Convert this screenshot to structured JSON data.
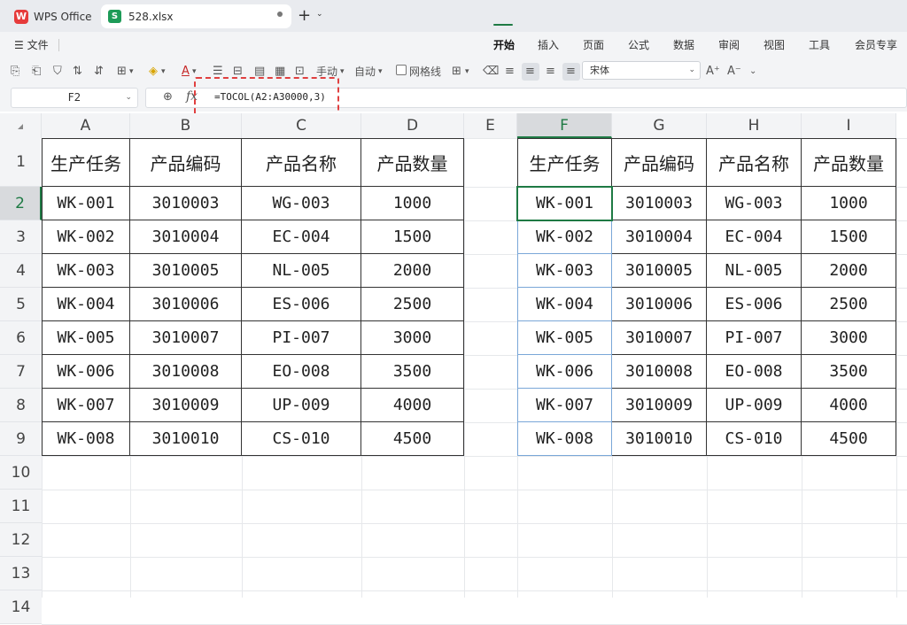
{
  "tabs": {
    "app_label": "WPS Office",
    "file_label": "528.xlsx",
    "plus": "+",
    "more": "⌄"
  },
  "menu": {
    "file": "☰ 文件",
    "items": [
      "开始",
      "插入",
      "页面",
      "公式",
      "数据",
      "审阅",
      "视图",
      "工具",
      "会员专享"
    ]
  },
  "toolbar": {
    "manual_label": "手动",
    "auto_label": "自动",
    "gridlines_label": "网格线",
    "font_name": "宋体",
    "font_grow": "A⁺",
    "font_shrink": "A⁻"
  },
  "formula_bar": {
    "cell_ref": "F2",
    "formula": "=TOCOL(A2:A30000,3)"
  },
  "columns": [
    "A",
    "B",
    "C",
    "D",
    "E",
    "F",
    "G",
    "H",
    "I"
  ],
  "rows": [
    "1",
    "2",
    "3",
    "4",
    "5",
    "6",
    "7",
    "8",
    "9",
    "10",
    "11",
    "12",
    "13",
    "14"
  ],
  "table": {
    "headers": [
      "生产任务",
      "产品编码",
      "产品名称",
      "产品数量"
    ],
    "rows": [
      [
        "WK-001",
        "3010003",
        "WG-003",
        "1000"
      ],
      [
        "WK-002",
        "3010004",
        "EC-004",
        "1500"
      ],
      [
        "WK-003",
        "3010005",
        "NL-005",
        "2000"
      ],
      [
        "WK-004",
        "3010006",
        "ES-006",
        "2500"
      ],
      [
        "WK-005",
        "3010007",
        "PI-007",
        "3000"
      ],
      [
        "WK-006",
        "3010008",
        "EO-008",
        "3500"
      ],
      [
        "WK-007",
        "3010009",
        "UP-009",
        "4000"
      ],
      [
        "WK-008",
        "3010010",
        "CS-010",
        "4500"
      ]
    ]
  },
  "colors": {
    "accent": "#1e7a44",
    "highlight": "#e04040"
  }
}
